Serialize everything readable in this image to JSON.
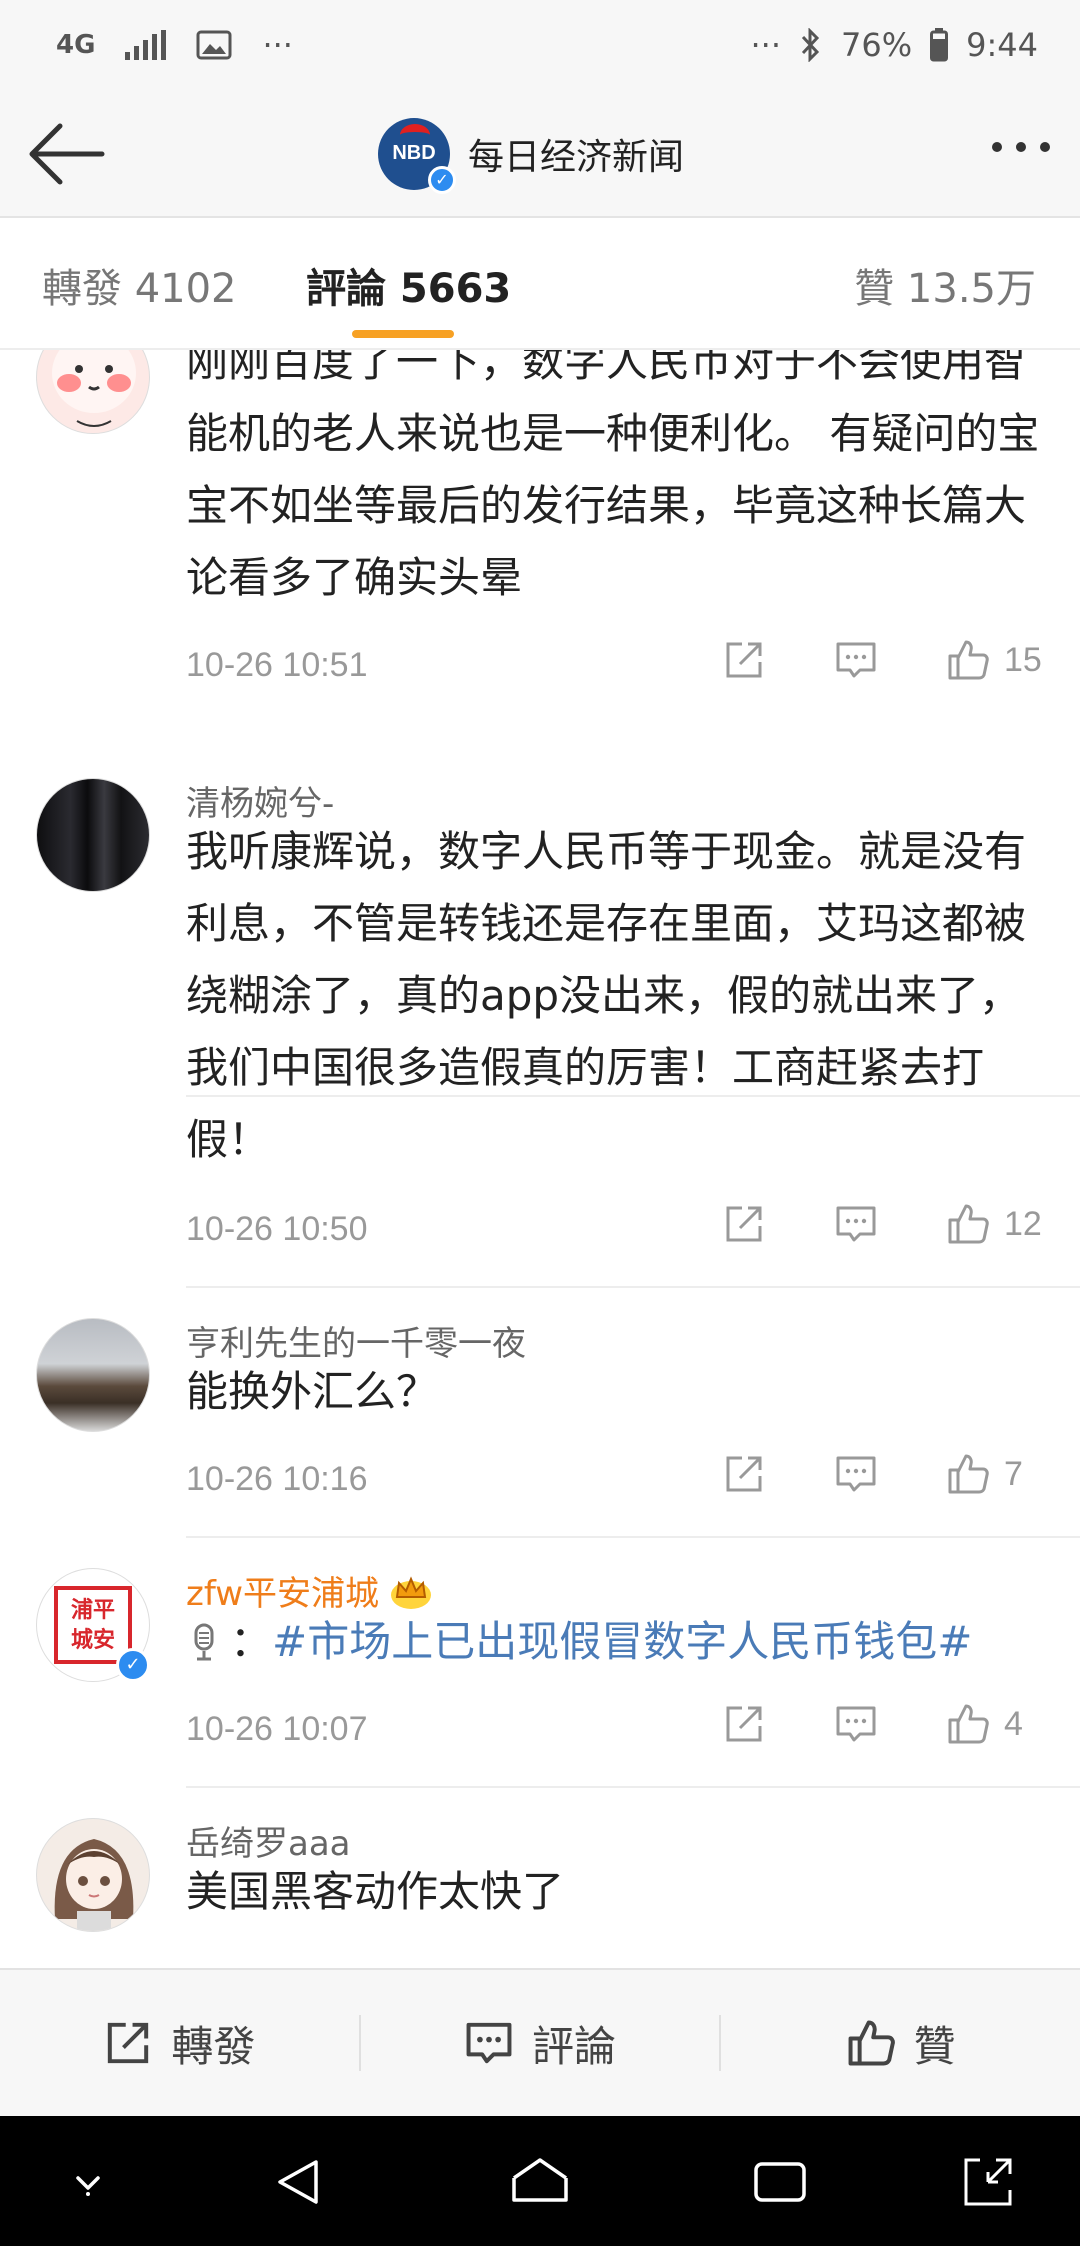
{
  "status_bar": {
    "network": "4G",
    "dots_left": "···",
    "dots_right": "···",
    "battery": "76%",
    "time": "9:44"
  },
  "nav": {
    "logo_text": "NBD",
    "title": "每日经济新闻"
  },
  "tabs": {
    "repost": "轉發 4102",
    "comment": "評論 5663",
    "like": "贊 13.5万"
  },
  "comments": [
    {
      "username": "",
      "text": "刚刚百度了一下，数字人民币对于不会使用智能机的老人来说也是一种便利化。 有疑问的宝宝不如坐等最后的发行结果，毕竟这种长篇大论看多了确实头晕",
      "time": "10-26 10:51",
      "likes": "15"
    },
    {
      "username": "清杨婉兮-",
      "text": "我听康辉说，数字人民币等于现金。就是没有利息，不管是转钱还是存在里面，艾玛这都被绕糊涂了，真的app没出来，假的就出来了，我们中国很多造假真的厉害！工商赶紧去打假！",
      "time": "10-26 10:50",
      "likes": "12"
    },
    {
      "username": "亨利先生的一千零一夜",
      "text": "能换外汇么？",
      "time": "10-26 10:16",
      "likes": "7"
    },
    {
      "username": "zfw平安浦城",
      "avatar_text": "浦平城安",
      "text_prefix": "：",
      "topic": "#市场上已出现假冒数字人民币钱包#",
      "time": "10-26 10:07",
      "likes": "4"
    },
    {
      "username": "岳绮罗aaa",
      "text": "美国黑客动作太快了",
      "time": "",
      "likes": ""
    }
  ],
  "bottom_bar": {
    "repost": "轉發",
    "comment": "評論",
    "like": "贊"
  },
  "colors": {
    "accent": "#f7a124",
    "vip_name": "#ef7d1a",
    "topic_link": "#4a7bb7",
    "brand_blue": "#1f4f8f"
  }
}
